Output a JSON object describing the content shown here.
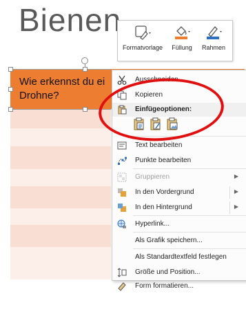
{
  "slide": {
    "title": "Bienen",
    "header_cell_line1": "Wie erkennst du ei",
    "header_cell_line2": "Drohne?"
  },
  "minibar": {
    "buttons": [
      {
        "label": "Formatvorlage",
        "icon": "shape-style-icon"
      },
      {
        "label": "Füllung",
        "icon": "fill-bucket-icon"
      },
      {
        "label": "Rahmen",
        "icon": "outline-pen-icon"
      }
    ]
  },
  "menu": {
    "cut": "Ausschneiden",
    "copy": "Kopieren",
    "paste_options": "Einfügeoptionen:",
    "edit_text": "Text bearbeiten",
    "edit_points": "Punkte bearbeiten",
    "group": "Gruppieren",
    "bring_front": "In den Vordergrund",
    "send_back": "In den Hintergrund",
    "hyperlink": "Hyperlink...",
    "save_as_picture": "Als Grafik speichern...",
    "set_default_textbox": "Als Standardtextfeld festlegen",
    "size_position": "Größe und Position...",
    "format_shape": "Form formatieren..."
  },
  "colors": {
    "header": "#ed7d31",
    "row_a": "#f8ded3",
    "row_b": "#fcefea",
    "annotation": "#e01010"
  }
}
